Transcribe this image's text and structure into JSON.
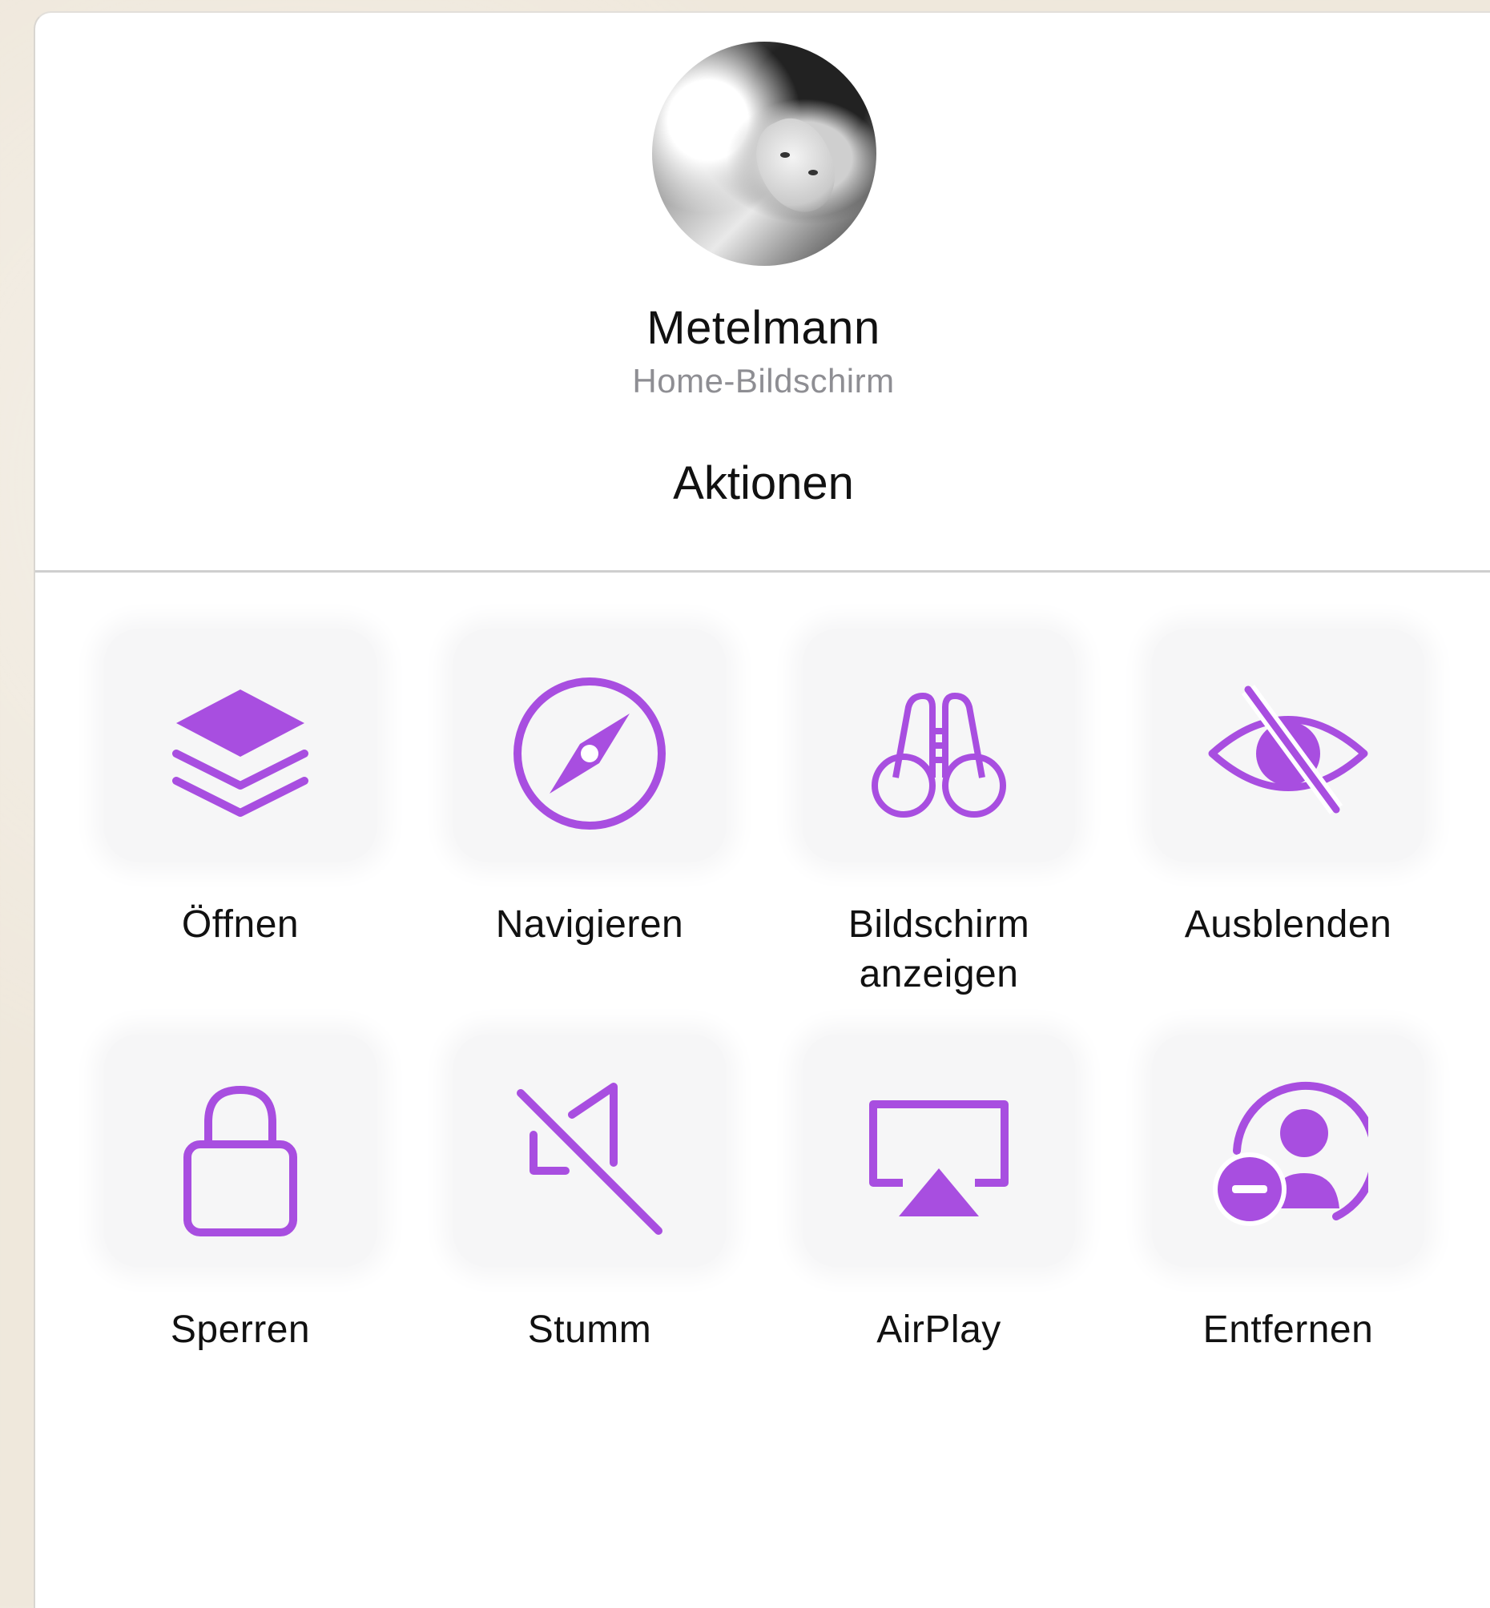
{
  "contact": {
    "name": "Metelmann",
    "subtitle": "Home-Bildschirm"
  },
  "section_title": "Aktionen",
  "accent_color": "#a84ee0",
  "actions": [
    {
      "label": "Öffnen",
      "icon": "layers-icon"
    },
    {
      "label": "Navigieren",
      "icon": "compass-icon"
    },
    {
      "label": "Bildschirm anzeigen",
      "icon": "binoculars-icon"
    },
    {
      "label": "Ausblenden",
      "icon": "eye-slash-icon"
    },
    {
      "label": "Sperren",
      "icon": "lock-icon"
    },
    {
      "label": "Stumm",
      "icon": "speaker-mute-icon"
    },
    {
      "label": "AirPlay",
      "icon": "airplay-icon"
    },
    {
      "label": "Entfernen",
      "icon": "person-remove-icon"
    }
  ]
}
